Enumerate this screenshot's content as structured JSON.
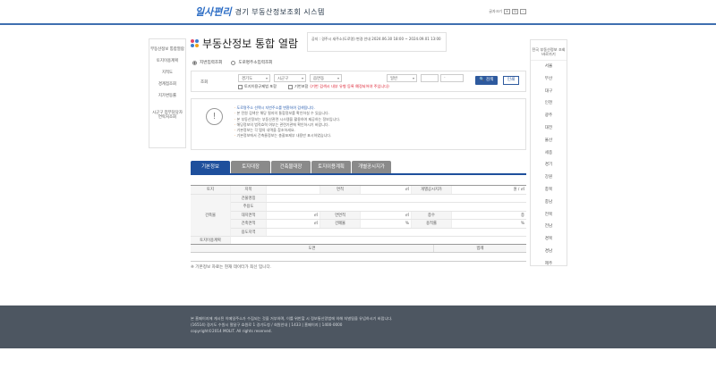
{
  "header": {
    "logo": "일사편리",
    "site_title": "경기 부동산정보조회 시스템",
    "font_size_label": "글자크기",
    "font_size_buttons": [
      "+",
      "0",
      "-"
    ]
  },
  "left_sidebar": {
    "items": [
      "부동산정보 통합열람",
      "토지이용계획",
      "지적도",
      "경계점조회",
      "지가변동률",
      "시군구 업무담당자 연락처조회"
    ]
  },
  "right_sidebar": {
    "top": "전국 부동산정보 조회 바로가기",
    "regions": [
      "서울",
      "부산",
      "대구",
      "인천",
      "광주",
      "대전",
      "울산",
      "세종",
      "경기",
      "강원",
      "충북",
      "충남",
      "전북",
      "전남",
      "경북",
      "경남",
      "제주"
    ]
  },
  "title": "부동산정보 통합 열람",
  "notice": "공지 : 경주시 새주소(도로명) 변경 안내 2024.06.30 18:00 ~ 2024.09.01 13:00",
  "search_type": {
    "options": [
      "지번입력조회",
      "도로명주소입력조회"
    ],
    "selected": 0
  },
  "search": {
    "label": "조회",
    "selects": [
      "경기도",
      "시군구",
      "읍면동",
      "일반"
    ],
    "input_placeholder": "-",
    "checkbox1": "토지이용규제법 포함",
    "checkbox2": "기번포함",
    "warning": "(기번 검색시 내부 유형 등록 예정되어야 주입니다)",
    "search_button": "검색",
    "print_button": "인쇄"
  },
  "info_items": [
    "도로명주소 선택시 지번주소를 변환하여 검색됩니다.",
    "본 민원 검색은 해당 필지의 통합정보를 확인하실 수 있습니다.",
    "본 부동산정보는 부동산관련 시스템을 활용하여 제공하는 정보입니다.",
    "해당정보의 법적효력 여부는 관련기관에 확인하시기 바랍니다.",
    "기본정보는 각 탭의 내역을 참조하세요.",
    "기본정보에서 건축물정보는 총괄표제부 내용만 표시하였습니다."
  ],
  "tabs": [
    "기본정보",
    "토지대장",
    "건축물대장",
    "토지이용계획",
    "개별공시지가"
  ],
  "table": {
    "toji": "토지",
    "jimok": "지목",
    "myeonjeok": "면적",
    "unit_m2": "㎡",
    "gongsi": "개별공시지가",
    "unit_won": "원 / ㎡",
    "geonchukmul": "건축물",
    "rows": [
      "건물명칭",
      "주용도",
      "대지면적",
      "건축면적",
      "용도지역"
    ],
    "yeonmyeonjeok": "연면적",
    "geonpyeyul": "건폐율",
    "pct": "%",
    "floors": "층수",
    "unit_floor": "층",
    "yongjeokyul": "용적률",
    "toji_iyong": "토지이용계획"
  },
  "bottom_table": {
    "col1": "도면",
    "col2": "범례"
  },
  "no_data": "※ 기본정보 자료는 현재 데이터가 최신 입니다.",
  "footer": {
    "line1": "본 홈페이지에 게시된 이메일주소가 수집되는 것을 거부하며, 이를 위반할 시 정보통신망법에 의해 처벌됨을 유념하시기 바랍니다.",
    "line2": "(16514) 경기도 수원시 팔달구 효원로 1 경기도청 / 회원안내 | 1433 | 홈페이지 | 1400-0000",
    "line3": "copyright©2014 MOLIT. All rights reserved."
  }
}
